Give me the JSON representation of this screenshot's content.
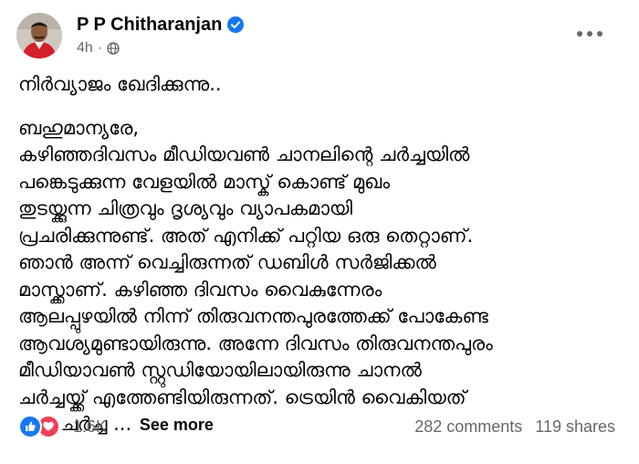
{
  "post": {
    "author_name": "P P Chitharanjan",
    "time_ago": "4h",
    "separator": "·",
    "title": "നിർവ്യാജം ഖേദിക്കുന്നു..",
    "body_lines": [
      "ബഹുമാന്യരേ,",
      "കഴിഞ്ഞദിവസം മീഡിയവൺ ചാനലിന്റെ ചർച്ചയിൽ",
      "പങ്കെടുക്കുന്ന വേളയിൽ മാസ്ക് കൊണ്ട് മുഖം",
      "തുടയ്ക്കുന്ന ചിത്രവും ദൃശ്യവും വ്യാപകമായി",
      "പ്രചരിക്കുന്നുണ്ട്. അത് എനിക്ക് പറ്റിയ ഒരു തെറ്റാണ്.",
      "ഞാൻ അന്ന് വെച്ചിരുന്നത് ഡബിൾ സർജിക്കൽ",
      "മാസ്ക്കാണ്. കഴിഞ്ഞ ദിവസം വൈകുന്നേരം",
      "ആലപ്പുഴയിൽ നിന്ന് തിരുവനന്തപുരത്തേക്ക് പോകേണ്ട",
      "ആവശ്യമുണ്ടായിരുന്നു. അന്നേ ദിവസം തിരുവനന്തപുരം",
      "മീഡിയാവൺ സ്റ്റുഡിയോയിലായിരുന്നു ചാനൽ",
      "ചർച്ചയ്ക്ക് എത്തേണ്ടിയിരുന്നത്. ട്രെയിൻ വൈകിയത്"
    ],
    "last_line": "മൂലം ചർച്ച ...",
    "see_more": "See more"
  },
  "footer": {
    "reaction_count": "1.6K",
    "comments": "282 comments",
    "shares": "119 shares"
  },
  "colors": {
    "like_blue": "#1877f2",
    "love_red": "#f33e58",
    "secondary_text": "#65676b"
  },
  "icons": {
    "verified": "verified-badge-icon",
    "audience": "globe-icon",
    "menu": "more-options-icon",
    "like": "like-reaction-icon",
    "love": "love-reaction-icon"
  }
}
